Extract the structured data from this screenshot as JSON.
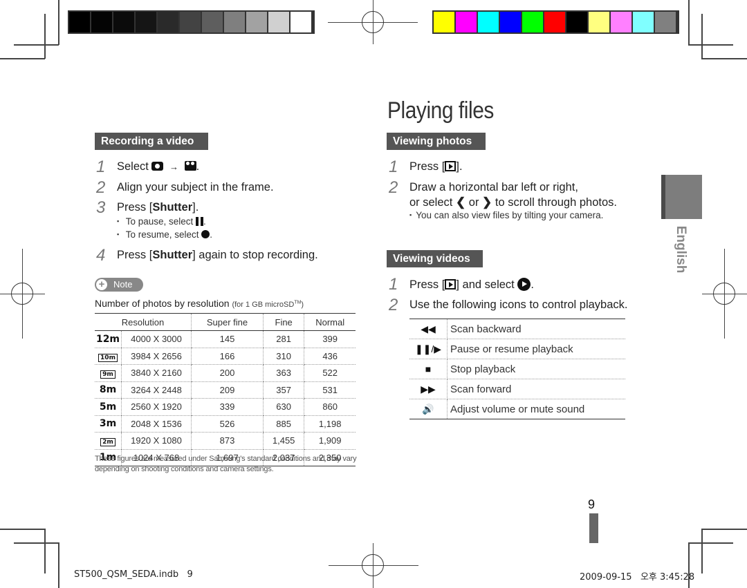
{
  "print_marks": {
    "gray_swatches": [
      "#000000",
      "#040404",
      "#0b0b0b",
      "#151515",
      "#2a2a2a",
      "#434343",
      "#5e5e5e",
      "#7f7f7f",
      "#a2a2a2",
      "#d0d0d0",
      "#ffffff"
    ],
    "color_swatches": [
      "#ffff00",
      "#ff00ff",
      "#00ffff",
      "#0000ff",
      "#00ff00",
      "#ff0000",
      "#000000",
      "#ffff80",
      "#ff80ff",
      "#80ffff",
      "#808080"
    ]
  },
  "page": {
    "title": "Playing files",
    "language_tab": "English",
    "page_number": "9",
    "footer_file": "ST500_QSM_SEDA.indb   9",
    "footer_timestamp": "2009-09-15   오후 3:45:28"
  },
  "recording": {
    "heading": "Recording a video",
    "steps": [
      {
        "num": "1",
        "pre": "Select ",
        "icon1": "camera-icon",
        "arrow": "→",
        "icon2": "video-camera-icon",
        "post": "."
      },
      {
        "num": "2",
        "text": "Align your subject in the frame."
      },
      {
        "num": "3",
        "pre": "Press [",
        "bold": "Shutter",
        "post": "]."
      },
      {
        "num": "4",
        "pre": "Press [",
        "bold": "Shutter",
        "post": "] again to stop recording."
      }
    ],
    "bullets": [
      {
        "pre": "To pause, select ",
        "icon": "pause-icon",
        "post": "."
      },
      {
        "pre": "To resume, select ",
        "icon": "record-icon",
        "post": "."
      }
    ]
  },
  "note": {
    "label": "Note",
    "table_title": "Number of photos by resolution",
    "table_subtitle": "(for 1 GB microSD",
    "table_subtitle_tm": "TM",
    "table_subtitle_end": ")",
    "columns": [
      "Resolution",
      "Super fine",
      "Fine",
      "Normal"
    ],
    "rows": [
      {
        "icon": "12m",
        "resolution": "4000 X 3000",
        "super_fine": "145",
        "fine": "281",
        "normal": "399"
      },
      {
        "icon": "10m",
        "resolution": "3984 X 2656",
        "super_fine": "166",
        "fine": "310",
        "normal": "436"
      },
      {
        "icon": "9m",
        "resolution": "3840 X 2160",
        "super_fine": "200",
        "fine": "363",
        "normal": "522"
      },
      {
        "icon": "8m",
        "resolution": "3264 X 2448",
        "super_fine": "209",
        "fine": "357",
        "normal": "531"
      },
      {
        "icon": "5m",
        "resolution": "2560 X 1920",
        "super_fine": "339",
        "fine": "630",
        "normal": "860"
      },
      {
        "icon": "3m",
        "resolution": "2048 X 1536",
        "super_fine": "526",
        "fine": "885",
        "normal": "1,198"
      },
      {
        "icon": "2m",
        "resolution": "1920 X 1080",
        "super_fine": "873",
        "fine": "1,455",
        "normal": "1,909"
      },
      {
        "icon": "1m",
        "resolution": "1024 X 768",
        "super_fine": "1,697",
        "fine": "2,037",
        "normal": "2,350"
      }
    ],
    "footnote": "These figures are measured under Samsung's standard conditions and may vary depending on shooting conditions and camera settings."
  },
  "viewing_photos": {
    "heading": "Viewing photos",
    "step1_pre": "Press [",
    "step1_post": "].",
    "step2_line1": "Draw a horizontal bar left or right,",
    "step2_line2_pre": "or select ",
    "step2_or": " or ",
    "step2_line2_post": " to scroll through photos.",
    "bullet": "You can also view files by tilting your camera."
  },
  "viewing_videos": {
    "heading": "Viewing videos",
    "step1_pre": "Press [",
    "step1_mid": "] and select ",
    "step1_post": ".",
    "step2": "Use the following icons to control playback.",
    "controls": [
      {
        "icon": "scan-backward-icon",
        "glyph": "◀◀",
        "label": "Scan backward"
      },
      {
        "icon": "pause-resume-icon",
        "glyph": "❚❚/▶",
        "label": "Pause or resume playback"
      },
      {
        "icon": "stop-icon",
        "glyph": "■",
        "label": "Stop playback"
      },
      {
        "icon": "scan-forward-icon",
        "glyph": "▶▶",
        "label": "Scan forward"
      },
      {
        "icon": "volume-icon",
        "glyph": "🔊",
        "label": "Adjust volume or mute sound"
      }
    ]
  }
}
